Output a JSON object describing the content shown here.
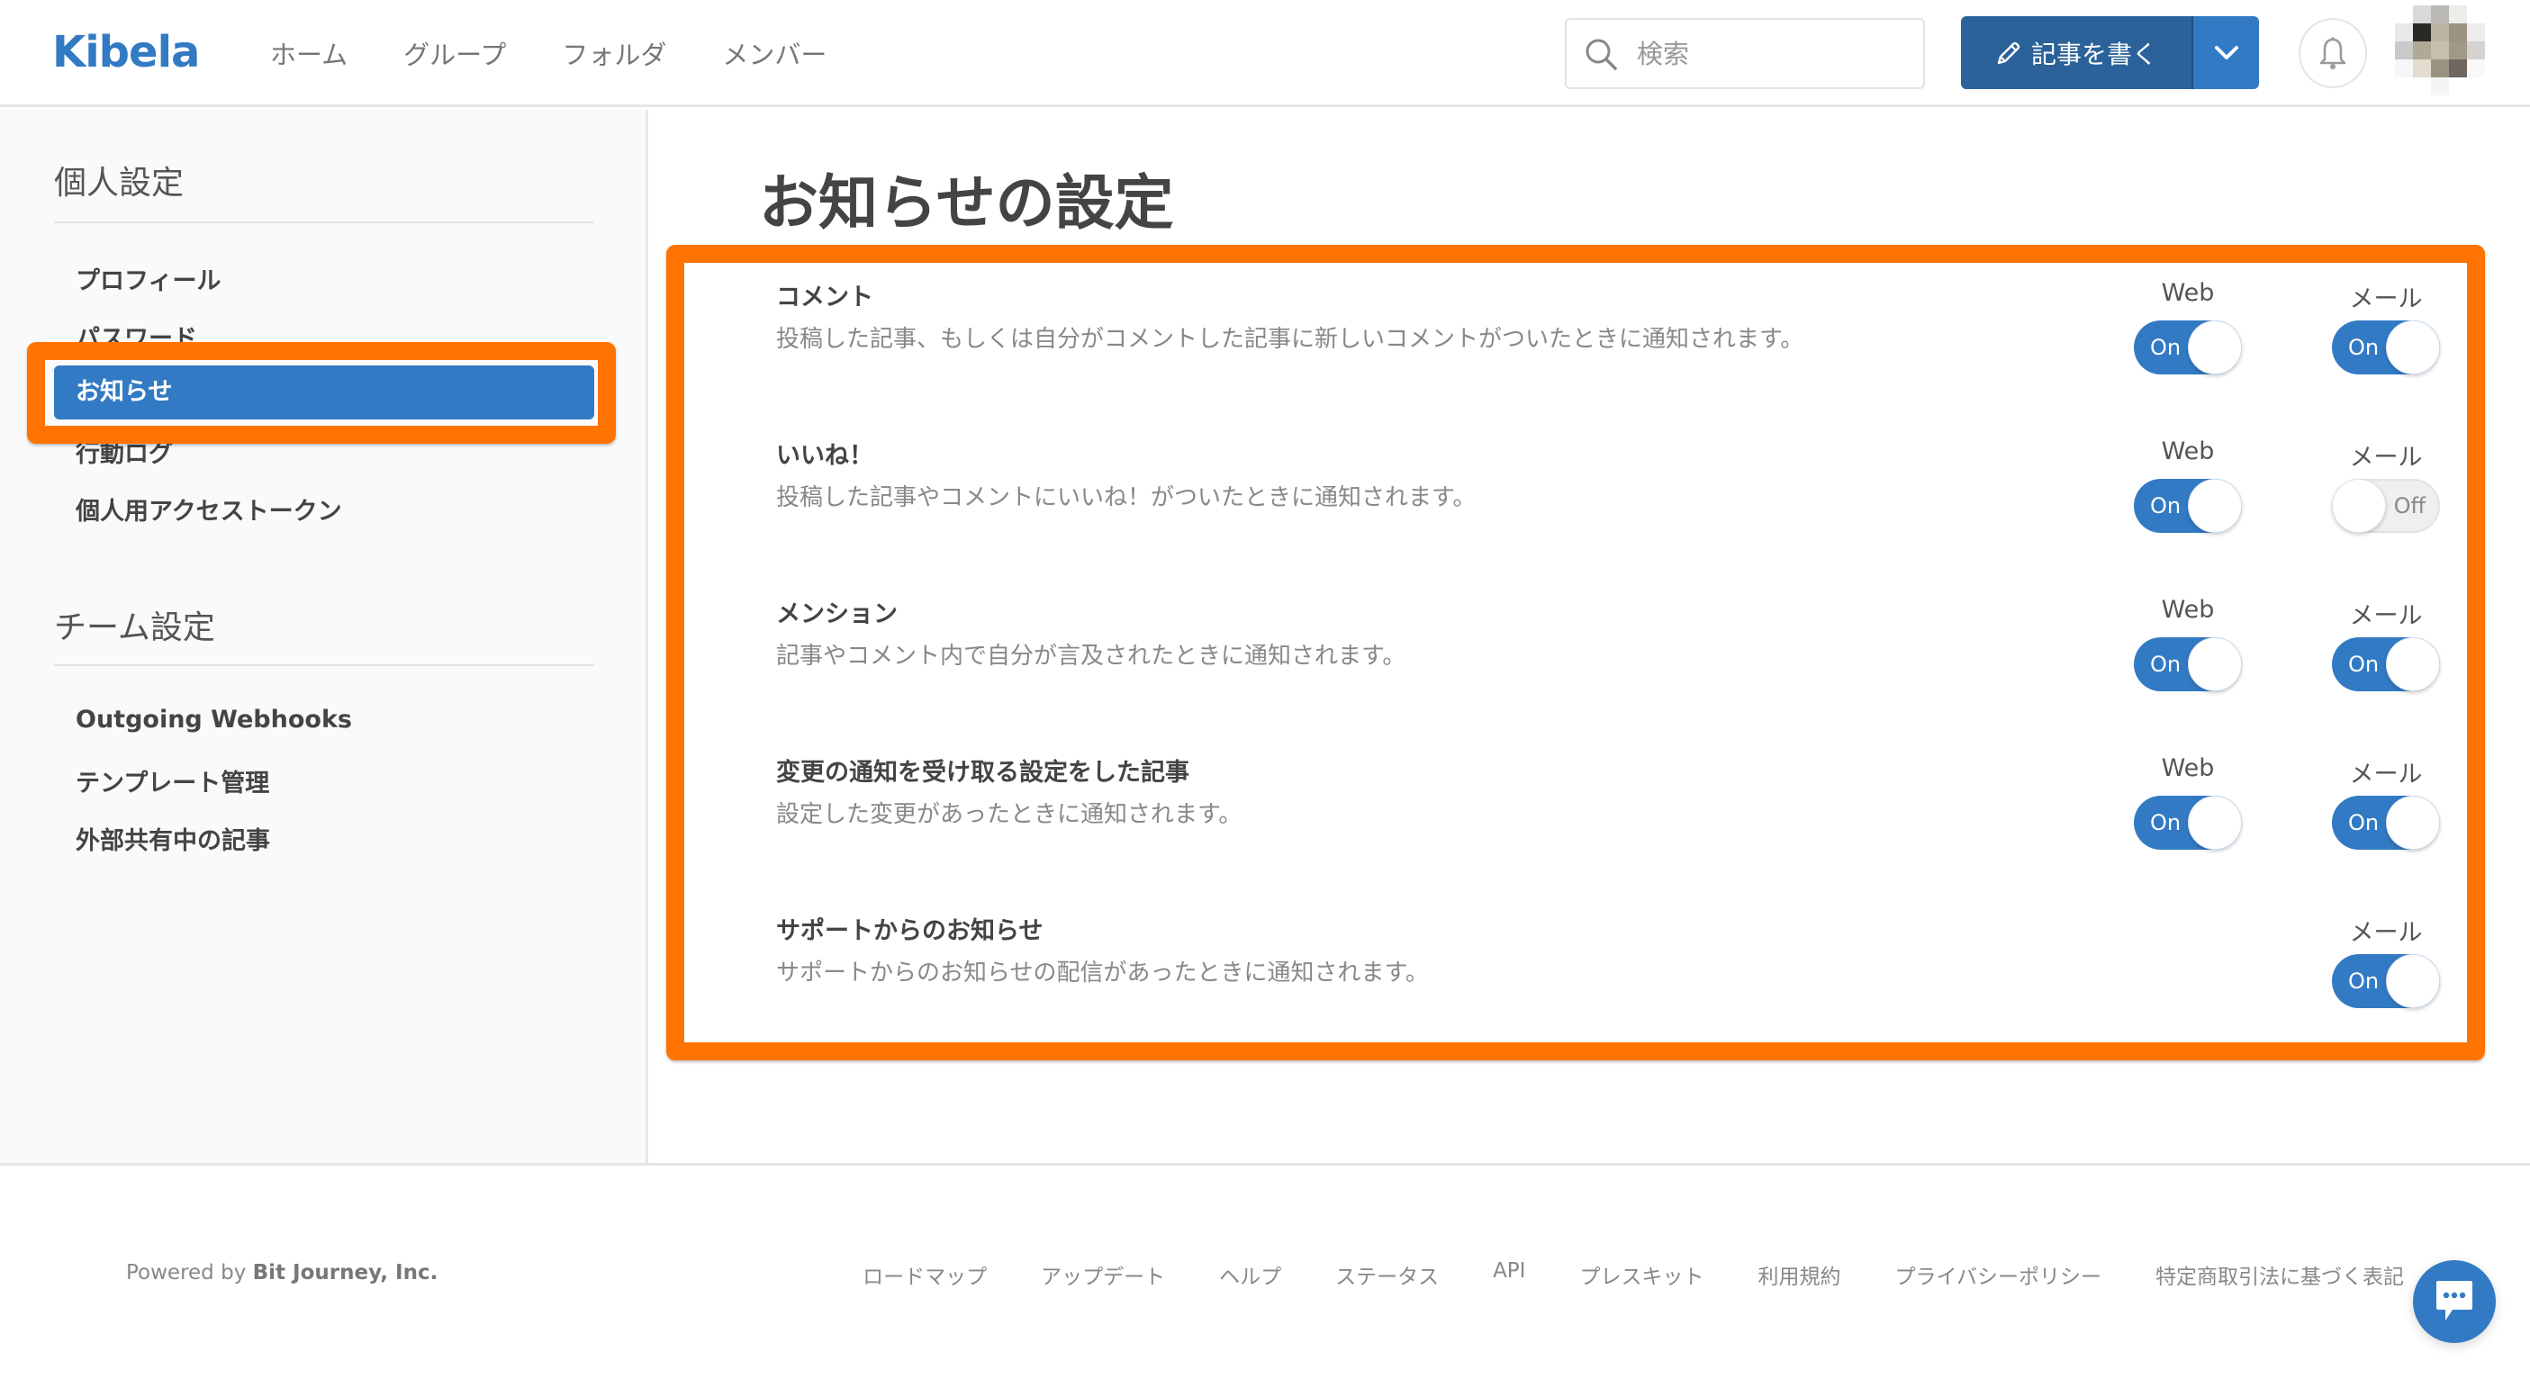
{
  "header": {
    "logo": "Kibela",
    "nav": [
      {
        "label": "ホーム"
      },
      {
        "label": "グループ"
      },
      {
        "label": "フォルダ"
      },
      {
        "label": "メンバー"
      }
    ],
    "search": {
      "placeholder": "検索",
      "value": ""
    },
    "write_button": {
      "label": "記事を書く"
    },
    "icons": {
      "search": "search-icon",
      "pencil": "pencil-icon",
      "dropdown": "chevron-down-icon",
      "bell": "bell-icon",
      "avatar": "avatar"
    }
  },
  "sidebar": {
    "personal": {
      "heading": "個人設定",
      "items": [
        {
          "label": "プロフィール",
          "active": false
        },
        {
          "label": "パスワード",
          "active": false
        },
        {
          "label": "お知らせ",
          "active": true
        },
        {
          "label": "行動ログ",
          "active": false
        },
        {
          "label": "個人用アクセストークン",
          "active": false
        }
      ]
    },
    "team": {
      "heading": "チーム設定",
      "items": [
        {
          "label": "Outgoing Webhooks"
        },
        {
          "label": "テンプレート管理"
        },
        {
          "label": "外部共有中の記事"
        }
      ]
    }
  },
  "main": {
    "title": "お知らせの設定",
    "column_labels": {
      "web": "Web",
      "mail": "メール"
    },
    "toggle_labels": {
      "on": "On",
      "off": "Off"
    },
    "settings": [
      {
        "title": "コメント",
        "description": "投稿した記事、もしくは自分がコメントした記事に新しいコメントがついたときに通知されます。",
        "web": true,
        "mail": true
      },
      {
        "title": "いいね！",
        "description": "投稿した記事やコメントにいいね！がついたときに通知されます。",
        "web": true,
        "mail": false
      },
      {
        "title": "メンション",
        "description": "記事やコメント内で自分が言及されたときに通知されます。",
        "web": true,
        "mail": true
      },
      {
        "title": "変更の通知を受け取る設定をした記事",
        "description": "設定した変更があったときに通知されます。",
        "web": true,
        "mail": true
      },
      {
        "title": "サポートからのお知らせ",
        "description": "サポートからのお知らせの配信があったときに通知されます。",
        "web": null,
        "mail": true
      }
    ]
  },
  "footer": {
    "powered_prefix": "Powered by",
    "powered_company": "Bit Journey, Inc.",
    "links": [
      {
        "label": "ロードマップ"
      },
      {
        "label": "アップデート"
      },
      {
        "label": "ヘルプ"
      },
      {
        "label": "ステータス"
      },
      {
        "label": "API"
      },
      {
        "label": "プレスキット"
      },
      {
        "label": "利用規約"
      },
      {
        "label": "プライバシーポリシー"
      },
      {
        "label": "特定商取引法に基づく表記"
      }
    ]
  },
  "colors": {
    "brand": "#337ac4",
    "brand_dark": "#2a6299",
    "highlight": "#ff7400",
    "toggle_off": "#efefef"
  }
}
